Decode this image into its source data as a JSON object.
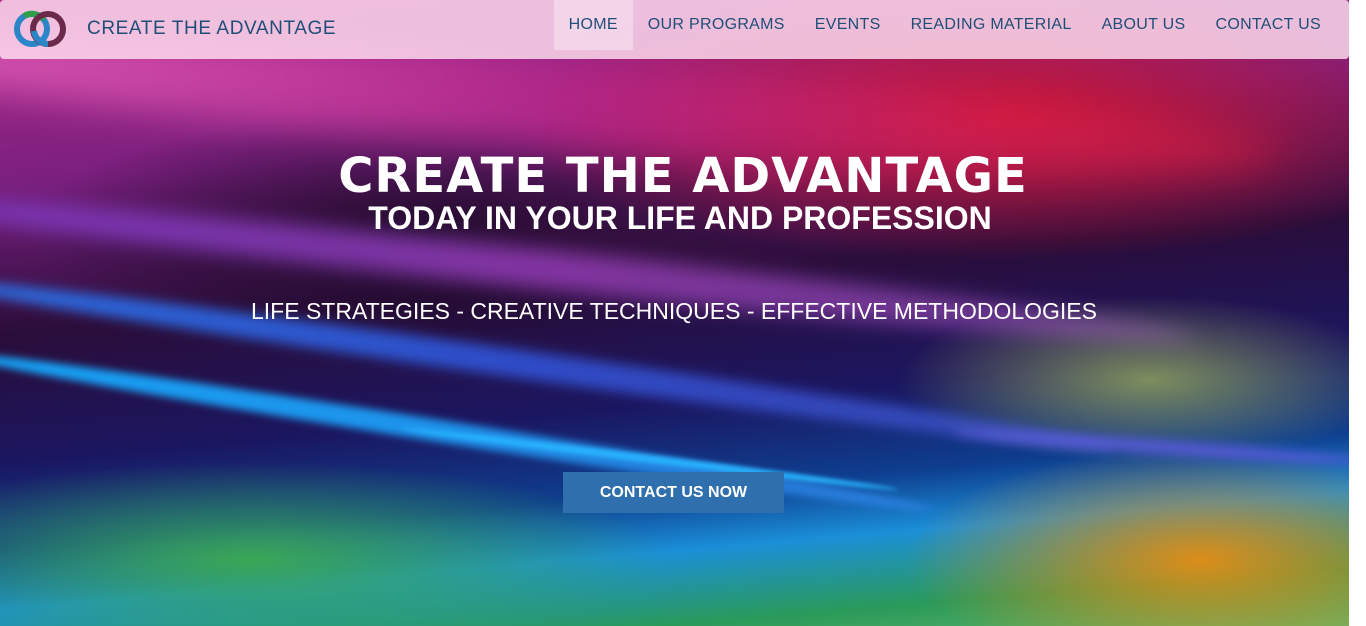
{
  "brand": {
    "name": "CREATE THE ADVANTAGE",
    "logo_icon": "interlocking-rings-logo"
  },
  "nav": {
    "items": [
      {
        "label": "HOME",
        "active": true
      },
      {
        "label": "OUR PROGRAMS",
        "active": false
      },
      {
        "label": "EVENTS",
        "active": false
      },
      {
        "label": "READING MATERIAL",
        "active": false
      },
      {
        "label": "ABOUT US",
        "active": false
      },
      {
        "label": "CONTACT US",
        "active": false
      }
    ]
  },
  "hero": {
    "title": "CREATE THE ADVANTAGE",
    "subtitle": "TODAY IN YOUR LIFE AND PROFESSION",
    "tagline": "LIFE STRATEGIES - CREATIVE TECHNIQUES - EFFECTIVE METHODOLOGIES",
    "cta_label": "CONTACT US NOW"
  },
  "colors": {
    "nav_text": "#1f4e79",
    "cta_background": "#2f6fad",
    "navbar_background": "#ffe1f0"
  }
}
